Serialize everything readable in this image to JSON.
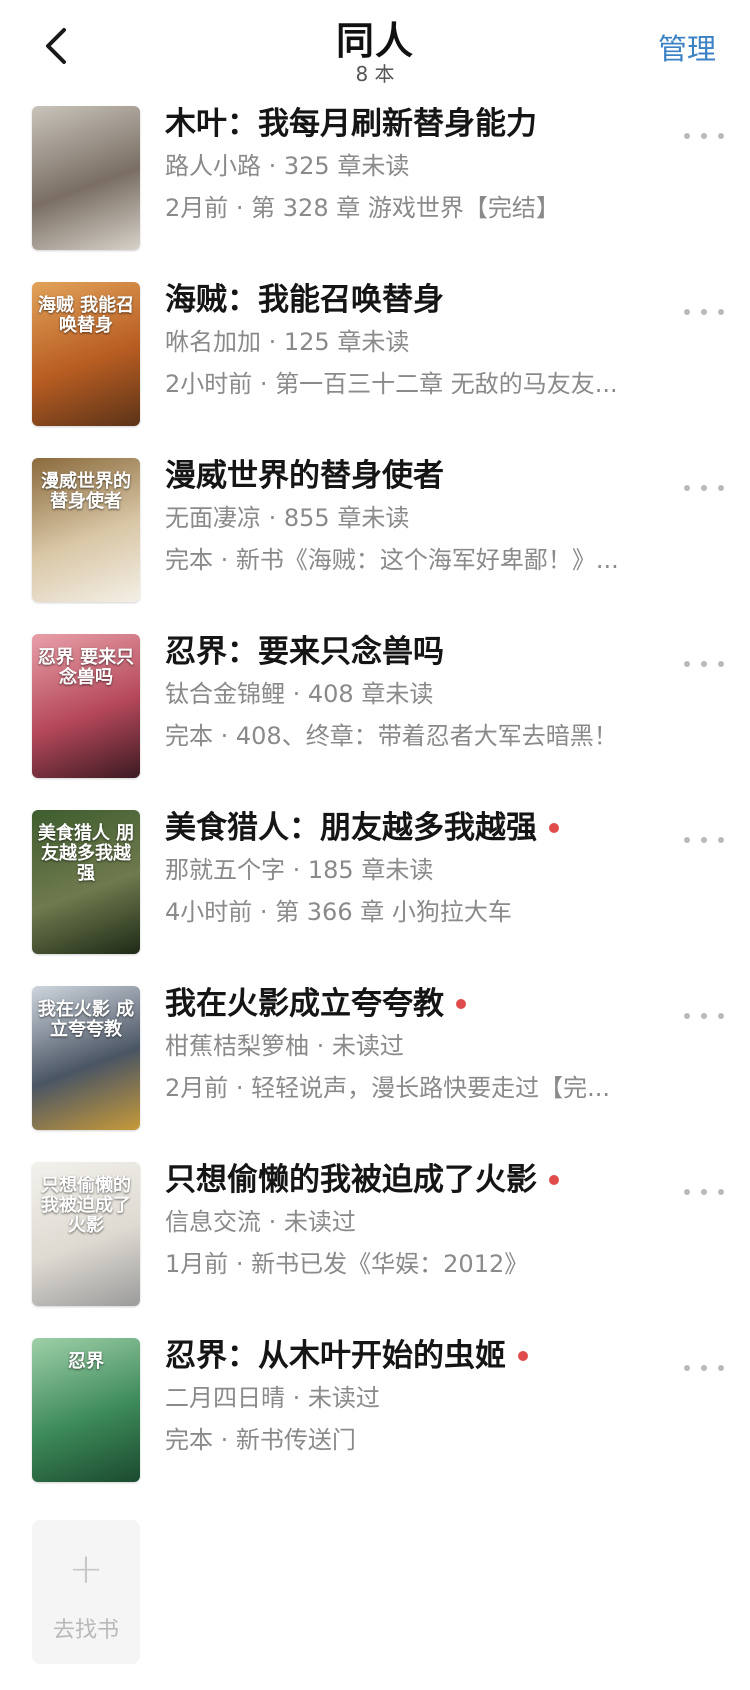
{
  "header": {
    "title": "同人",
    "count": "8 本",
    "manage_label": "管理"
  },
  "books": [
    {
      "title": "木叶：我每月刷新替身能力",
      "author_progress": "路人小路 · 325 章未读",
      "latest": "2月前 · 第 328 章 游戏世界【完结】",
      "new_dot": false,
      "cover_colors": [
        "#c9c4bb",
        "#7a6e64",
        "#d7d2c8"
      ],
      "cover_text": ""
    },
    {
      "title": "海贼：我能召唤替身",
      "author_progress": "咻名加加 · 125 章未读",
      "latest": "2小时前 · 第一百三十二章 无敌的马友友...",
      "new_dot": false,
      "cover_colors": [
        "#e2a25a",
        "#b85d22",
        "#5b3318"
      ],
      "cover_text": "海贼 我能召唤替身"
    },
    {
      "title": "漫威世界的替身使者",
      "author_progress": "无面凄凉 · 855 章未读",
      "latest": "完本 · 新书《海贼：这个海军好卑鄙！》...",
      "new_dot": false,
      "cover_colors": [
        "#8a6a3c",
        "#d9c7a6",
        "#f4efe6"
      ],
      "cover_text": "漫威世界的 替身使者"
    },
    {
      "title": "忍界：要来只念兽吗",
      "author_progress": "钛合金锦鲤 · 408 章未读",
      "latest": "完本 · 408、终章：带着忍者大军去暗黑！",
      "new_dot": false,
      "cover_colors": [
        "#e8a0a8",
        "#b5485a",
        "#3c1a22"
      ],
      "cover_text": "忍界 要来只念兽吗"
    },
    {
      "title": "美食猎人：朋友越多我越强",
      "author_progress": "那就五个字 · 185 章未读",
      "latest": "4小时前 · 第 366 章 小狗拉大车",
      "new_dot": true,
      "cover_colors": [
        "#3e5d2e",
        "#6f7a4e",
        "#1e2a16"
      ],
      "cover_text": "美食猎人 朋友越多我越强"
    },
    {
      "title": "我在火影成立夸夸教",
      "author_progress": "柑蕉桔梨箩柚 · 未读过",
      "latest": "2月前 · 轻轻说声，漫长路快要走过【完...",
      "new_dot": true,
      "cover_colors": [
        "#cfd6de",
        "#4a5564",
        "#c79a3a"
      ],
      "cover_text": "我在火影 成立夸夸教"
    },
    {
      "title": "只想偷懒的我被迫成了火影",
      "author_progress": "信息交流 · 未读过",
      "latest": "1月前 · 新书已发《华娱：2012》",
      "new_dot": true,
      "cover_colors": [
        "#f3f1ec",
        "#dedad2",
        "#9b9b9b"
      ],
      "cover_text": "只想偷懒的 我被迫成了火影"
    },
    {
      "title": "忍界：从木叶开始的虫姬",
      "author_progress": "二月四日晴 · 未读过",
      "latest": "完本 · 新书传送门",
      "new_dot": true,
      "cover_colors": [
        "#9fd0a8",
        "#3d8a5a",
        "#1b4a2e"
      ],
      "cover_text": "忍界"
    }
  ],
  "add_card": {
    "plus": "+",
    "label": "去找书"
  }
}
